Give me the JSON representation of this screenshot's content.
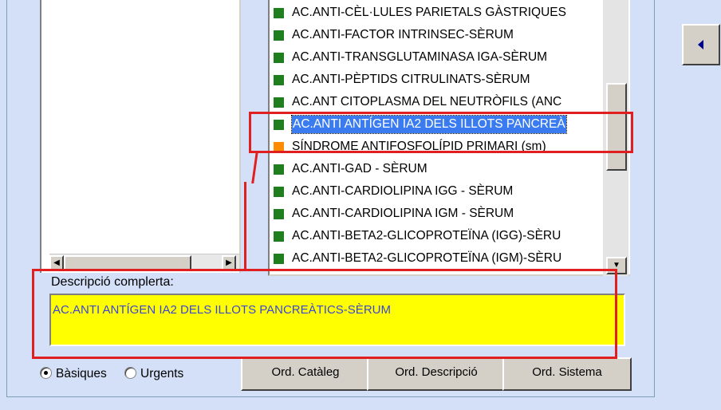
{
  "list": {
    "items": [
      {
        "label": "AC.ANTI-CÈL·LULES PARIETALS GÀSTRIQUES",
        "color": "#1f7f1f"
      },
      {
        "label": "AC.ANTI-FACTOR INTRINSEC-SÈRUM",
        "color": "#1f7f1f"
      },
      {
        "label": "AC.ANTI-TRANSGLUTAMINASA IGA-SÈRUM",
        "color": "#1f7f1f"
      },
      {
        "label": "AC.ANTI-PÈPTIDS CITRULINATS-SÈRUM",
        "color": "#1f7f1f"
      },
      {
        "label": "AC.ANT CITOPLASMA DEL NEUTRÒFILS (ANC",
        "color": "#1f7f1f"
      },
      {
        "label": "AC.ANTI ANTÍGEN IA2 DELS ILLOTS PANCREÀ",
        "color": "#1f7f1f",
        "selected": true
      },
      {
        "label": "SÍNDROME ANTIFOSFOLÍPID PRIMARI (sm)",
        "color": "#ff8c00"
      },
      {
        "label": "AC.ANTI-GAD - SÈRUM",
        "color": "#1f7f1f"
      },
      {
        "label": "AC.ANTI-CARDIOLIPINA IGG - SÈRUM",
        "color": "#1f7f1f"
      },
      {
        "label": "AC.ANTI-CARDIOLIPINA IGM - SÈRUM",
        "color": "#1f7f1f"
      },
      {
        "label": "AC.ANTI-BETA2-GLICOPROTEÏNA (IGG)-SÈRU",
        "color": "#1f7f1f"
      },
      {
        "label": "AC.ANTI-BETA2-GLICOPROTEÏNA (IGM)-SÈRU",
        "color": "#1f7f1f"
      }
    ]
  },
  "description": {
    "label": "Descripció complerta:",
    "value": "AC.ANTI ANTÍGEN IA2 DELS ILLOTS PANCREÀTICS-SÈRUM"
  },
  "radios": {
    "basic_label": "Bàsiques",
    "urgent_label": "Urgents",
    "selected": "basic"
  },
  "buttons": {
    "catalog": "Ord. Catàleg",
    "description": "Ord. Descripció",
    "system": "Ord. Sistema"
  },
  "icons": {
    "side_button": "triangle-left-icon",
    "scroll_left": "triangle-left-icon",
    "scroll_right": "triangle-right-icon",
    "scroll_down": "triangle-down-icon"
  },
  "colors": {
    "selection": "#3a7cf0",
    "description_bg": "#ffff00",
    "description_text": "#3b46d8",
    "highlight": "#e02020"
  }
}
